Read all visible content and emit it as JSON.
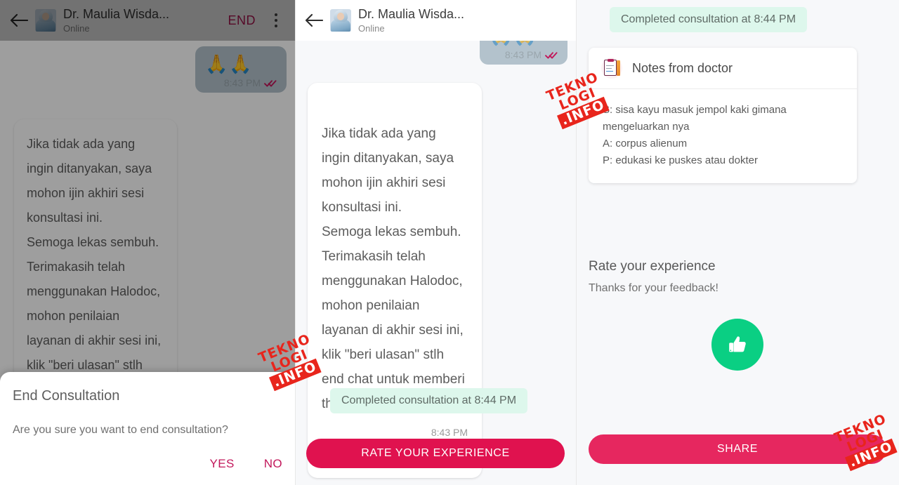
{
  "panels": {
    "one": {
      "header": {
        "back_icon": "arrow-left-icon",
        "avatar": "doctor-avatar",
        "name": "Dr. Maulia Wisda...",
        "status": "Online",
        "end_label": "END",
        "menu_icon": "kebab-menu-icon"
      },
      "sent_message": {
        "emoji": "🙏🙏",
        "time": "8:43 PM",
        "read_icon": "double-check-icon"
      },
      "received_message": {
        "text": "Jika tidak ada yang ingin ditanyakan, saya mohon ijin akhiri sesi konsultasi ini.\nSemoga lekas sembuh. Terimakasih telah menggunakan Halodoc, mohon penilaian layanan di akhir sesi ini, klik \"beri ulasan\" stlh end chat untuk memberi thump"
      },
      "dialog": {
        "title": "End Consultation",
        "message": "Are you sure you want to end consultation?",
        "yes_label": "YES",
        "no_label": "NO"
      }
    },
    "two": {
      "header": {
        "back_icon": "arrow-left-icon",
        "avatar": "doctor-avatar",
        "name": "Dr. Maulia Wisda...",
        "status": "Online"
      },
      "sent_message_partial": {
        "time": "8:43 PM",
        "read_icon": "double-check-icon"
      },
      "received_message": {
        "text": "Jika tidak ada yang ingin ditanyakan, saya mohon ijin akhiri sesi konsultasi ini.\nSemoga lekas sembuh. Terimakasih telah menggunakan Halodoc, mohon penilaian layanan di akhir sesi ini, klik \"beri ulasan\" stlh end chat untuk memberi thump up (jempol)",
        "time": "8:43 PM"
      },
      "system_pill": "Completed consultation at 8:44 PM",
      "cta_label": "RATE YOUR EXPERIENCE"
    },
    "three": {
      "system_pill": "Completed consultation at 8:44 PM",
      "notes_card": {
        "icon": "clipboard-notes-icon",
        "title": "Notes from doctor",
        "body": "S: sisa kayu masuk jempol kaki gimana mengeluarkan nya\nA: corpus alienum\nP: edukasi ke puskes atau dokter"
      },
      "rate_section": {
        "title": "Rate your experience",
        "subtitle": "Thanks for your feedback!",
        "rating_icon": "thumbs-up-icon"
      },
      "cta_label": "SHARE"
    }
  },
  "watermark": {
    "line1": "TEKNO",
    "line2": "LOGI",
    "line3": ".INFO"
  },
  "colors": {
    "accent_pink": "#e0124f",
    "end_red": "#c2185b",
    "success_green": "#0ACF83",
    "pill_green_bg": "#ddf7ec",
    "watermark_red": "#e8251c",
    "out_bubble": "#b3c2cc"
  }
}
